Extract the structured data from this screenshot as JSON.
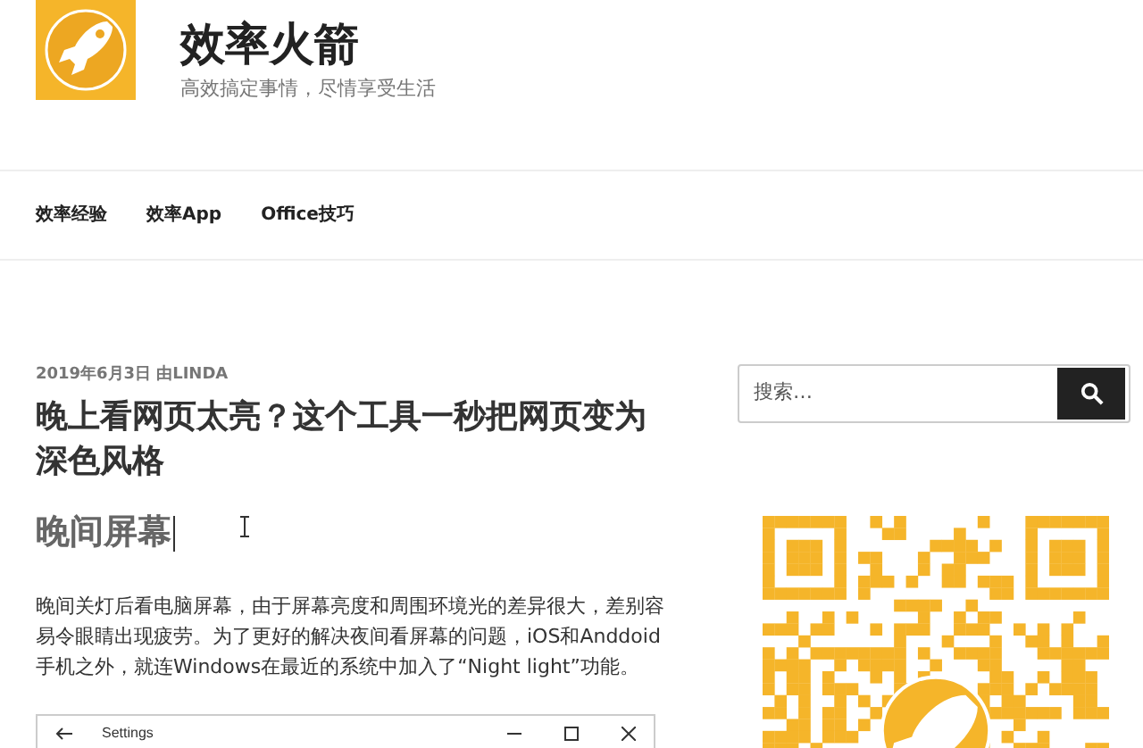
{
  "site": {
    "title": "效率火箭",
    "tagline": "高效搞定事情，尽情享受生活"
  },
  "nav": [
    {
      "label": "效率经验"
    },
    {
      "label": "效率App"
    },
    {
      "label": "Office技巧"
    }
  ],
  "post": {
    "date": "2019年6月3日",
    "byline": "由LINDA",
    "title": "晚上看网页太亮？这个工具一秒把网页变为深色风格",
    "heading": "晚间屏幕",
    "paragraph": "晚间关灯后看电脑屏幕，由于屏幕亮度和周围环境光的差异很大，差别容易令眼睛出现疲劳。为了更好的解决夜间看屏幕的问题，iOS和Anddoid手机之外，就连Windows在最近的系统中加入了“Night light”功能。",
    "screenshot": {
      "title": "Settings"
    }
  },
  "sidebar": {
    "search": {
      "placeholder": "搜索…"
    }
  }
}
